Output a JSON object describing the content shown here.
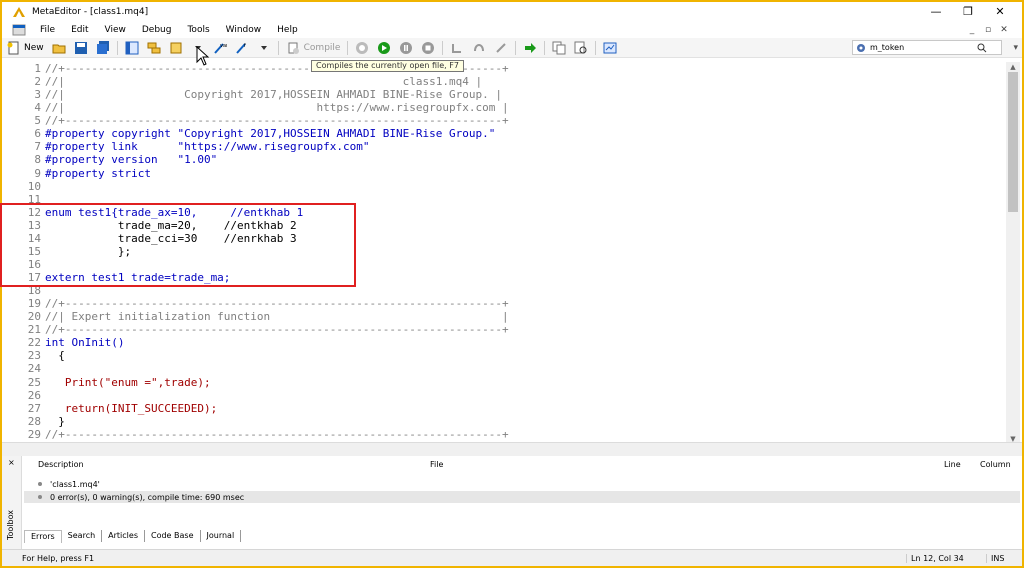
{
  "window": {
    "title": "MetaEditor - [class1.mq4]",
    "minimize": "—",
    "restore": "❐",
    "close": "✕"
  },
  "menu": [
    "File",
    "Edit",
    "View",
    "Debug",
    "Tools",
    "Window",
    "Help"
  ],
  "mdi_controls": [
    "_",
    "▫",
    "✕"
  ],
  "toolbar": {
    "new_label": "New",
    "search_value": "m_token",
    "compile_label": "Compile"
  },
  "tooltip": "Compiles the currently open file, F7",
  "code_lines": [
    {
      "n": "1",
      "t": "//+------------------------------------------------------------------+"
    },
    {
      "n": "2",
      "t": "//|                                                   class1.mq4 |"
    },
    {
      "n": "3",
      "t": "//|                  Copyright 2017,HOSSEIN AHMADI BINE-Rise Group. |"
    },
    {
      "n": "4",
      "t": "//|                                      https://www.risegroupfx.com |"
    },
    {
      "n": "5",
      "t": "//+------------------------------------------------------------------+"
    },
    {
      "n": "6",
      "t": "#property copyright \"Copyright 2017,HOSSEIN AHMADI BINE-Rise Group.\""
    },
    {
      "n": "7",
      "t": "#property link      \"https://www.risegroupfx.com\""
    },
    {
      "n": "8",
      "t": "#property version   \"1.00\""
    },
    {
      "n": "9",
      "t": "#property strict"
    },
    {
      "n": "10",
      "t": ""
    },
    {
      "n": "11",
      "t": ""
    },
    {
      "n": "12",
      "t": "enum test1{trade_ax=10,     //entkhab 1"
    },
    {
      "n": "13",
      "t": "           trade_ma=20,    //entkhab 2"
    },
    {
      "n": "14",
      "t": "           trade_cci=30    //enrkhab 3"
    },
    {
      "n": "15",
      "t": "           };"
    },
    {
      "n": "16",
      "t": ""
    },
    {
      "n": "17",
      "t": "extern test1 trade=trade_ma;"
    },
    {
      "n": "18",
      "t": ""
    },
    {
      "n": "19",
      "t": "//+------------------------------------------------------------------+"
    },
    {
      "n": "20",
      "t": "//| Expert initialization function                                   |"
    },
    {
      "n": "21",
      "t": "//+------------------------------------------------------------------+"
    },
    {
      "n": "22",
      "t": "int OnInit()"
    },
    {
      "n": "23",
      "t": "  {"
    },
    {
      "n": "24",
      "t": ""
    },
    {
      "n": "25",
      "t": "   Print(\"enum =\",trade);"
    },
    {
      "n": "26",
      "t": ""
    },
    {
      "n": "27",
      "t": "   return(INIT_SUCCEEDED);"
    },
    {
      "n": "28",
      "t": "  }"
    },
    {
      "n": "29",
      "t": "//+------------------------------------------------------------------+"
    }
  ],
  "toolbox": {
    "label": "Toolbox",
    "close": "×",
    "columns": {
      "description": "Description",
      "file": "File",
      "line": "Line",
      "column": "Column"
    },
    "rows": [
      "'class1.mq4'",
      "0 error(s), 0 warning(s), compile time: 690 msec"
    ],
    "tabs": [
      "Errors",
      "Search",
      "Articles",
      "Code Base",
      "Journal"
    ]
  },
  "status": {
    "help": "For Help, press F1",
    "position": "Ln 12, Col 34",
    "mode": "INS"
  },
  "colors": {
    "accent_border": "#f0b400",
    "highlight_box": "#e02020",
    "keyword": "#0000c0",
    "string": "#008080",
    "comment": "#808080"
  }
}
